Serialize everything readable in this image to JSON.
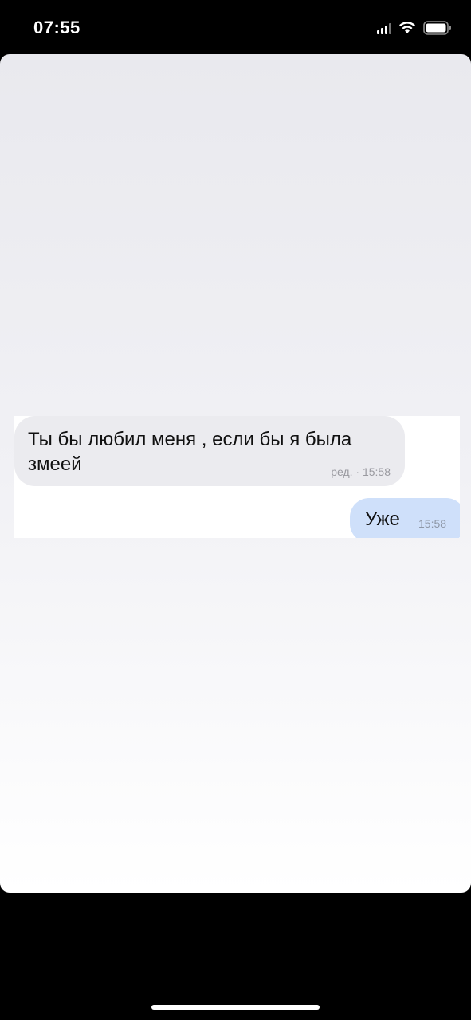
{
  "status_bar": {
    "time": "07:55",
    "icons": [
      "signal-icon",
      "wifi-icon",
      "battery-icon"
    ]
  },
  "chat": {
    "incoming_message": {
      "text": "Ты бы любил  меня , если бы я была змеей",
      "meta": "ред. · 15:58"
    },
    "outgoing_message": {
      "text": "Уже",
      "time": "15:58"
    }
  },
  "colors": {
    "incoming_bubble": "#ebebef",
    "outgoing_bubble": "#cfe0fa",
    "background": "#000000"
  }
}
